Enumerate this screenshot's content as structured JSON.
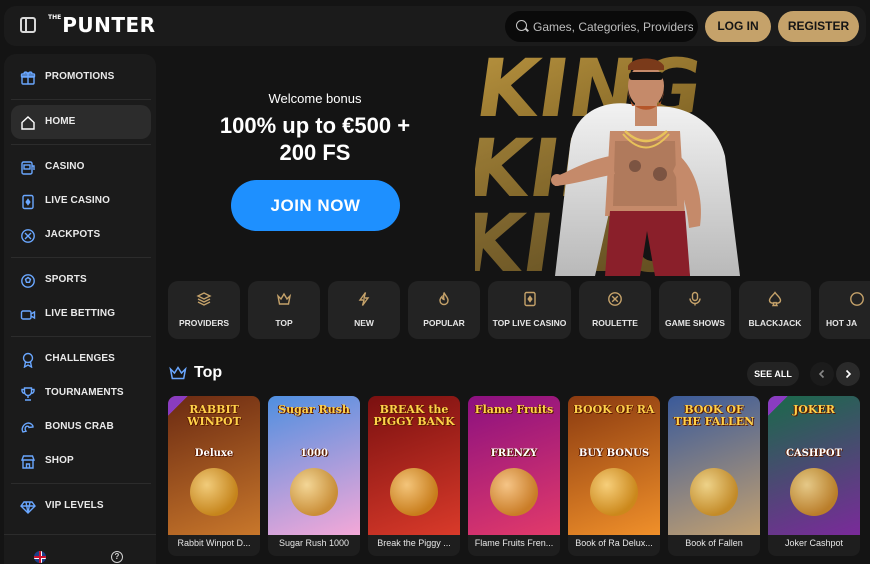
{
  "header": {
    "logo_prefix": "THE",
    "logo": "PUNTER",
    "search_placeholder": "Games, Categories, Providers",
    "login_label": "LOG IN",
    "register_label": "REGISTER"
  },
  "sidebar": {
    "items": [
      {
        "label": "PROMOTIONS",
        "icon": "gift-icon"
      },
      {
        "label": "HOME",
        "icon": "home-icon",
        "active": true
      },
      {
        "label": "CASINO",
        "icon": "slot-machine-icon"
      },
      {
        "label": "LIVE CASINO",
        "icon": "card-icon"
      },
      {
        "label": "JACKPOTS",
        "icon": "chip-icon"
      },
      {
        "label": "SPORTS",
        "icon": "football-icon"
      },
      {
        "label": "LIVE BETTING",
        "icon": "video-icon"
      },
      {
        "label": "CHALLENGES",
        "icon": "medal-icon"
      },
      {
        "label": "TOURNAMENTS",
        "icon": "trophy-icon"
      },
      {
        "label": "BONUS CRAB",
        "icon": "crab-claw-icon"
      },
      {
        "label": "SHOP",
        "icon": "shop-icon"
      },
      {
        "label": "VIP LEVELS",
        "icon": "diamond-icon"
      }
    ],
    "help_glyph": "?"
  },
  "hero": {
    "subtitle": "Welcome bonus",
    "title_line1": "100% up to €500 +",
    "title_line2": "200 FS",
    "cta_label": "JOIN NOW",
    "art_word": "KING"
  },
  "categories": [
    {
      "label": "PROVIDERS",
      "icon": "layers-icon"
    },
    {
      "label": "TOP",
      "icon": "crown-icon"
    },
    {
      "label": "NEW",
      "icon": "lightning-icon"
    },
    {
      "label": "POPULAR",
      "icon": "flame-icon"
    },
    {
      "label": "TOP LIVE CASINO",
      "icon": "card-icon"
    },
    {
      "label": "ROULETTE",
      "icon": "roulette-icon"
    },
    {
      "label": "GAME SHOWS",
      "icon": "microphone-icon"
    },
    {
      "label": "BLACKJACK",
      "icon": "spade-icon"
    },
    {
      "label": "HOT JA",
      "icon": "chip-icon"
    }
  ],
  "section": {
    "title": "Top",
    "see_all_label": "SEE ALL"
  },
  "games": [
    {
      "name": "Rabbit Winpot D...",
      "art_title": "RABBIT WINPOT",
      "art_sub": "Deluxe",
      "colors": [
        "#6b2a12",
        "#c8772b"
      ]
    },
    {
      "name": "Sugar Rush 1000",
      "art_title": "Sugar Rush",
      "art_sub": "1000",
      "colors": [
        "#4f8fe0",
        "#f4a8d8"
      ]
    },
    {
      "name": "Break the Piggy ...",
      "art_title": "BREAK the PIGGY BANK",
      "art_sub": "",
      "colors": [
        "#7a1010",
        "#d93a2a"
      ]
    },
    {
      "name": "Flame Fruits Fren...",
      "art_title": "Flame Fruits",
      "art_sub": "FRENZY",
      "colors": [
        "#8b1080",
        "#e23a6a"
      ]
    },
    {
      "name": "Book of Ra Delux...",
      "art_title": "BOOK OF RA",
      "art_sub": "BUY BONUS",
      "colors": [
        "#8a3a10",
        "#f0902a"
      ]
    },
    {
      "name": "Book of Fallen",
      "art_title": "BOOK OF THE FALLEN",
      "art_sub": "",
      "colors": [
        "#3a5a9a",
        "#c2a070"
      ]
    },
    {
      "name": "Joker Cashpot",
      "art_title": "JOKER",
      "art_sub": "CASHPOT",
      "colors": [
        "#1a6a4a",
        "#7a2a9a"
      ]
    }
  ]
}
